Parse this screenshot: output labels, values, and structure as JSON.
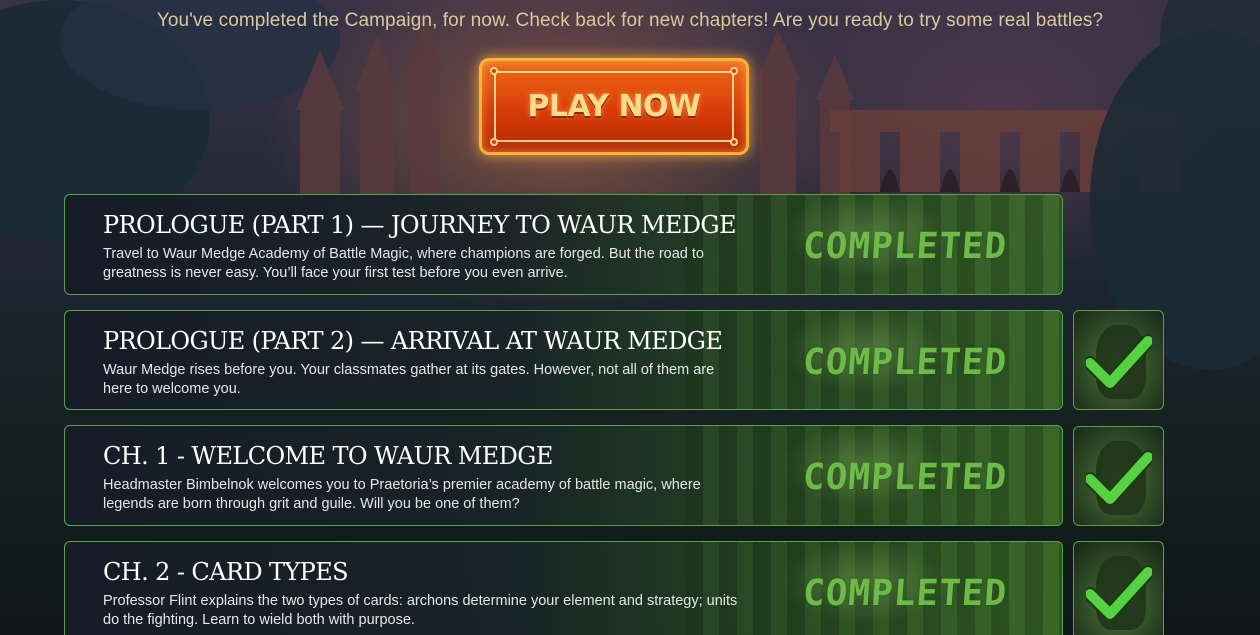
{
  "headline": "You've completed the Campaign, for now. Check back for new chapters! Are you ready to try some real battles?",
  "play_button": {
    "label": "PLAY NOW"
  },
  "status_color": "#56d141",
  "chapters": [
    {
      "title": "PROLOGUE (PART 1) — JOURNEY TO WAUR MEDGE",
      "description": "Travel to Waur Medge Academy of Battle Magic, where champions are forged. But the road to greatness is never easy. You’ll face your first test before you even arrive.",
      "status": "COMPLETED",
      "has_thumbnail": false
    },
    {
      "title": "PROLOGUE (PART 2) — ARRIVAL AT WAUR MEDGE",
      "description": "Waur Medge rises before you. Your classmates gather at its gates. However, not all of them are here to welcome you.",
      "status": "COMPLETED",
      "has_thumbnail": true,
      "thumbnail_icon": "checkmark-icon"
    },
    {
      "title": "CH. 1 - WELCOME TO WAUR MEDGE",
      "description": "Headmaster Bimbelnok welcomes you to Praetoria’s premier academy of battle magic, where legends are born through grit and guile. Will you be one of them?",
      "status": "COMPLETED",
      "has_thumbnail": true,
      "thumbnail_icon": "checkmark-icon"
    },
    {
      "title": "CH. 2 - CARD TYPES",
      "description": "Professor Flint explains the two types of cards: archons determine your element and strategy; units do the fighting. Learn to wield both with purpose.",
      "status": "COMPLETED",
      "has_thumbnail": true,
      "thumbnail_icon": "checkmark-icon"
    }
  ]
}
